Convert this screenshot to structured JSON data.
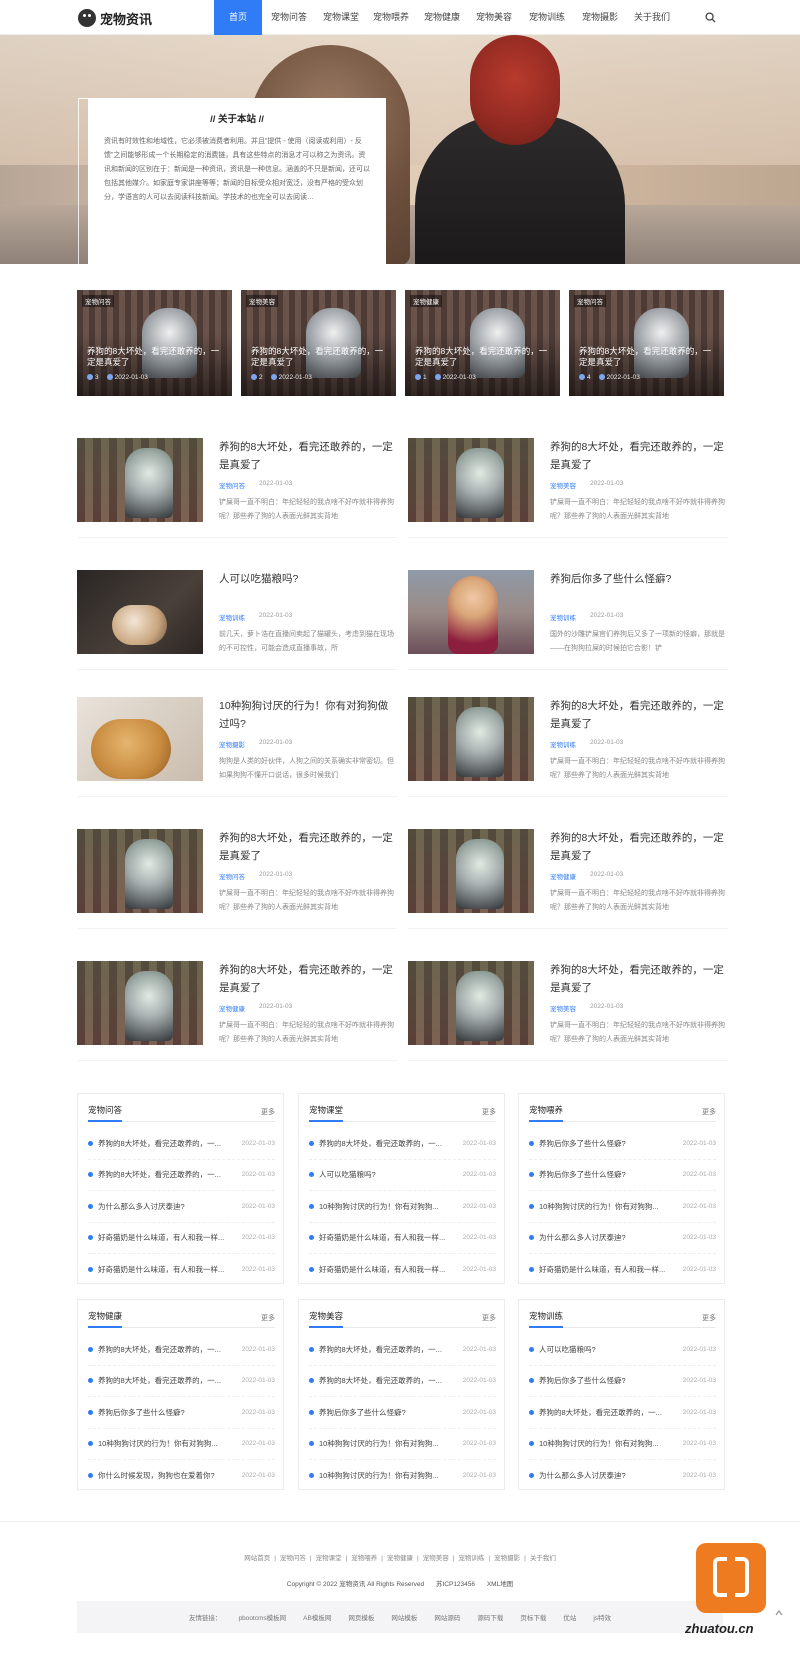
{
  "brand": {
    "name": "宠物资讯",
    "accent": "#2f7cf6"
  },
  "nav": {
    "items": [
      "首页",
      "宠物问答",
      "宠物课堂",
      "宠物喂养",
      "宠物健康",
      "宠物美容",
      "宠物训练",
      "宠物摄影",
      "关于我们"
    ],
    "active": "首页"
  },
  "about": {
    "title": "// 关于本站 //",
    "text": "资讯有时效性和地域性，它必须被消费者利用。并且“提供 - 使用（阅读或利用）- 反馈”之间能够形成一个长期稳定的消费链，具有这些特点的消息才可以称之为资讯。资讯和新闻的区别在于：新闻是一种资讯，资讯是一种信息。涵盖的不只是新闻，还可以包括其他媒介。如家庭专家讲座等等；新闻的目标受众相对宽泛，没有严格的受众划分，学语言的人可以去阅读科技新闻。学技术的也完全可以去阅读…"
  },
  "cards": [
    {
      "tag": "宠物问答",
      "title": "养狗的8大坏处，看完还敢养的，一定是真爱了",
      "count": "3",
      "date": "2022-01-03"
    },
    {
      "tag": "宠物美容",
      "title": "养狗的8大坏处，看完还敢养的，一定是真爱了",
      "count": "2",
      "date": "2022-01-03"
    },
    {
      "tag": "宠物健康",
      "title": "养狗的8大坏处，看完还敢养的，一定是真爱了",
      "count": "1",
      "date": "2022-01-03"
    },
    {
      "tag": "宠物问答",
      "title": "养狗的8大坏处，看完还敢养的，一定是真爱了",
      "count": "4",
      "date": "2022-01-03"
    }
  ],
  "articles": [
    {
      "image": "husky",
      "title": "养狗的8大坏处，看完还敢养的，一定是真爱了",
      "category": "宠物问答",
      "date": "2022-01-03",
      "desc": "铲屎哥一直不明白：年纪轻轻的我点啥不好咋就非得养狗呢？那些养了狗的人表面光鲜其实背地"
    },
    {
      "image": "husky",
      "title": "养狗的8大坏处，看完还敢养的，一定是真爱了",
      "category": "宠物美容",
      "date": "2022-01-03",
      "desc": "铲屎哥一直不明白：年纪轻轻的我点啥不好咋就非得养狗呢？那些养了狗的人表面光鲜其实背地"
    },
    {
      "image": "kitten",
      "title": "人可以吃猫粮吗?",
      "category": "宠物训练",
      "date": "2022-01-03",
      "desc": "前几天，萝卜浩在直播间卖起了猫罐头，考虑到猫在现场的不可控性，可能会造成直播事故，所"
    },
    {
      "image": "girl",
      "title": "养狗后你多了些什么怪癖?",
      "category": "宠物训练",
      "date": "2022-01-03",
      "desc": "国外的沙雕铲屎官们养狗后又多了一项新的怪癖，那就是——在狗狗拉屎的时候拍它合影！铲"
    },
    {
      "image": "woman",
      "title": "10种狗狗讨厌的行为！你有对狗狗做过吗?",
      "category": "宠物摄影",
      "date": "2022-01-03",
      "desc": "狗狗是人类的好伙伴，人狗之间的关系确实非常密切。但如果狗狗不懂开口说话，很多时候我们"
    },
    {
      "image": "husky",
      "title": "养狗的8大坏处，看完还敢养的，一定是真爱了",
      "category": "宠物训练",
      "date": "2022-01-03",
      "desc": "铲屎哥一直不明白：年纪轻轻的我点啥不好咋就非得养狗呢？那些养了狗的人表面光鲜其实背地"
    },
    {
      "image": "husky",
      "title": "养狗的8大坏处，看完还敢养的，一定是真爱了",
      "category": "宠物问答",
      "date": "2022-01-03",
      "desc": "铲屎哥一直不明白：年纪轻轻的我点啥不好咋就非得养狗呢？那些养了狗的人表面光鲜其实背地"
    },
    {
      "image": "husky",
      "title": "养狗的8大坏处，看完还敢养的，一定是真爱了",
      "category": "宠物健康",
      "date": "2022-01-03",
      "desc": "铲屎哥一直不明白：年纪轻轻的我点啥不好咋就非得养狗呢？那些养了狗的人表面光鲜其实背地"
    },
    {
      "image": "husky",
      "title": "养狗的8大坏处，看完还敢养的，一定是真爱了",
      "category": "宠物健康",
      "date": "2022-01-03",
      "desc": "铲屎哥一直不明白：年纪轻轻的我点啥不好咋就非得养狗呢？那些养了狗的人表面光鲜其实背地"
    },
    {
      "image": "husky",
      "title": "养狗的8大坏处，看完还敢养的，一定是真爱了",
      "category": "宠物美容",
      "date": "2022-01-03",
      "desc": "铲屎哥一直不明白：年纪轻轻的我点啥不好咋就非得养狗呢？那些养了狗的人表面光鲜其实背地"
    }
  ],
  "lists": [
    {
      "title": "宠物问答",
      "more": "更多",
      "items": [
        {
          "title": "养狗的8大坏处，看完还敢养的，一...",
          "date": "2022-01-03"
        },
        {
          "title": "养狗的8大坏处，看完还敢养的，一...",
          "date": "2022-01-03"
        },
        {
          "title": "为什么那么多人讨厌泰迪?",
          "date": "2022-01-03"
        },
        {
          "title": "好奇猫奶是什么味道，有人和我一样...",
          "date": "2022-01-03"
        },
        {
          "title": "好奇猫奶是什么味道，有人和我一样...",
          "date": "2022-01-03"
        }
      ]
    },
    {
      "title": "宠物课堂",
      "more": "更多",
      "items": [
        {
          "title": "养狗的8大坏处，看完还敢养的，一...",
          "date": "2022-01-03"
        },
        {
          "title": "人可以吃猫粮吗?",
          "date": "2022-01-03"
        },
        {
          "title": "10种狗狗讨厌的行为！你有对狗狗...",
          "date": "2022-01-03"
        },
        {
          "title": "好奇猫奶是什么味道，有人和我一样...",
          "date": "2022-01-03"
        },
        {
          "title": "好奇猫奶是什么味道，有人和我一样...",
          "date": "2022-01-03"
        }
      ]
    },
    {
      "title": "宠物喂养",
      "more": "更多",
      "items": [
        {
          "title": "养狗后你多了些什么怪癖?",
          "date": "2022-01-03"
        },
        {
          "title": "养狗后你多了些什么怪癖?",
          "date": "2022-01-03"
        },
        {
          "title": "10种狗狗讨厌的行为！你有对狗狗...",
          "date": "2022-01-03"
        },
        {
          "title": "为什么那么多人讨厌泰迪?",
          "date": "2022-01-03"
        },
        {
          "title": "好奇猫奶是什么味道，有人和我一样...",
          "date": "2022-01-03"
        }
      ]
    },
    {
      "title": "宠物健康",
      "more": "更多",
      "items": [
        {
          "title": "养狗的8大坏处，看完还敢养的，一...",
          "date": "2022-01-03"
        },
        {
          "title": "养狗的8大坏处，看完还敢养的，一...",
          "date": "2022-01-03"
        },
        {
          "title": "养狗后你多了些什么怪癖?",
          "date": "2022-01-03"
        },
        {
          "title": "10种狗狗讨厌的行为！你有对狗狗...",
          "date": "2022-01-03"
        },
        {
          "title": "你什么时候发现，狗狗也在爱着你?",
          "date": "2022-01-03"
        }
      ]
    },
    {
      "title": "宠物美容",
      "more": "更多",
      "items": [
        {
          "title": "养狗的8大坏处，看完还敢养的，一...",
          "date": "2022-01-03"
        },
        {
          "title": "养狗的8大坏处，看完还敢养的，一...",
          "date": "2022-01-03"
        },
        {
          "title": "养狗后你多了些什么怪癖?",
          "date": "2022-01-03"
        },
        {
          "title": "10种狗狗讨厌的行为！你有对狗狗...",
          "date": "2022-01-03"
        },
        {
          "title": "10种狗狗讨厌的行为！你有对狗狗...",
          "date": "2022-01-03"
        }
      ]
    },
    {
      "title": "宠物训练",
      "more": "更多",
      "items": [
        {
          "title": "人可以吃猫粮吗?",
          "date": "2022-01-03"
        },
        {
          "title": "养狗后你多了些什么怪癖?",
          "date": "2022-01-03"
        },
        {
          "title": "养狗的8大坏处，看完还敢养的，一...",
          "date": "2022-01-03"
        },
        {
          "title": "10种狗狗讨厌的行为！你有对狗狗...",
          "date": "2022-01-03"
        },
        {
          "title": "为什么那么多人讨厌泰迪?",
          "date": "2022-01-03"
        }
      ]
    }
  ],
  "footer": {
    "nav": [
      "网站首页",
      "宠物问答",
      "宠物课堂",
      "宠物喂养",
      "宠物健康",
      "宠物美容",
      "宠物训练",
      "宠物摄影",
      "关于我们"
    ],
    "separator": "|",
    "copyright": "Copyright © 2022 宠物资讯 All Rights Reserved",
    "icp": "苏ICP123456",
    "sitemap": "XML地图",
    "links_label": "友情链接：",
    "links": [
      "pbootcms模板网",
      "AB模板网",
      "网页模板",
      "网站模板",
      "网站源码",
      "源码下载",
      "页标下载",
      "优站",
      "js特效"
    ]
  },
  "watermark": "zhuatou.cn"
}
